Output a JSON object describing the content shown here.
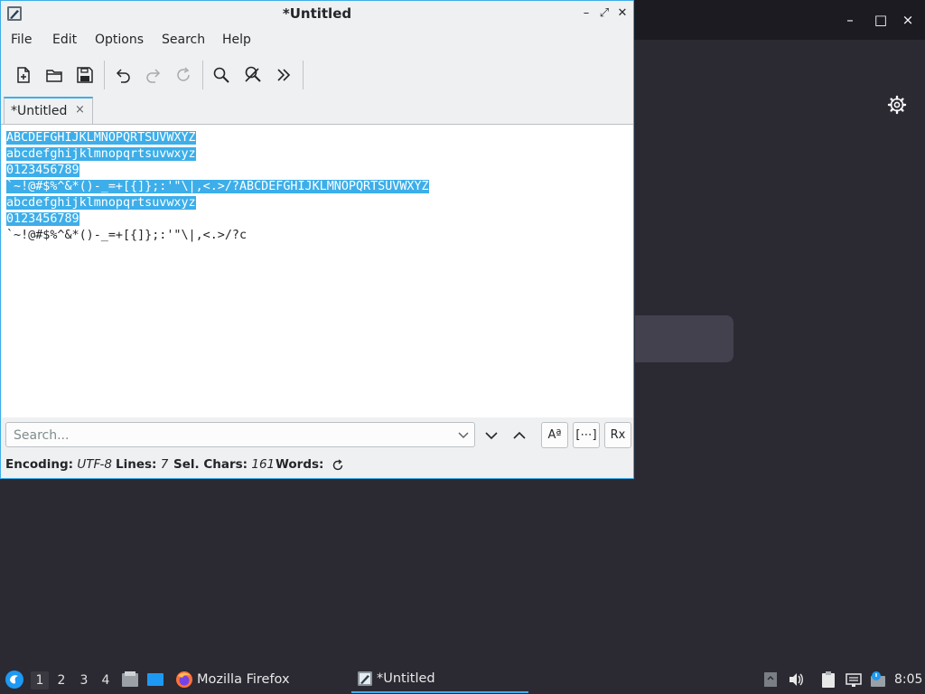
{
  "background_window": {
    "controls": {
      "minimize": "–",
      "maximize": "□",
      "close": "×"
    },
    "menu_icon": "hamburger-icon",
    "settings_icon": "gear-icon"
  },
  "editor_window": {
    "title": "*Untitled",
    "controls": {
      "minimize": "–",
      "maximize": "⤢",
      "close": "✕"
    },
    "menu": [
      "File",
      "Edit",
      "Options",
      "Search",
      "Help"
    ],
    "toolbar": [
      "new-file",
      "open-file",
      "save",
      "undo",
      "redo",
      "reload",
      "find",
      "find-replace",
      "more"
    ],
    "tab": {
      "label": "*Untitled",
      "close": "×"
    },
    "document": {
      "selected_lines": [
        "ABCDEFGHIJKLMNOPQRTSUVWXYZ",
        "abcdefghijklmnopqrtsuvwxyz",
        "0123456789",
        "`~!@#$%^&*()-_=+[{]};:'\"\\|,<.>/?ABCDEFGHIJKLMNOPQRTSUVWXYZ",
        "abcdefghijklmnopqrtsuvwxyz",
        "0123456789"
      ],
      "unselected_line": "`~!@#$%^&*()-_=+[{]};:'\"\\|,<.>/?c"
    },
    "search": {
      "placeholder": "Search...",
      "value": "",
      "options": {
        "match_case": "Aª",
        "whole_word": "[⋯]",
        "regex": "Rx"
      }
    },
    "status": {
      "encoding_label": "Encoding:",
      "encoding_value": "UTF-8",
      "lines_label": "Lines:",
      "lines_value": "7",
      "selchars_label": "Sel. Chars:",
      "selchars_value": "161",
      "words_label": "Words:"
    }
  },
  "taskbar": {
    "workspaces": [
      "1",
      "2",
      "3",
      "4"
    ],
    "active_workspace": "1",
    "tasks": [
      {
        "label": "Mozilla Firefox",
        "icon": "firefox-icon"
      },
      {
        "label": "*Untitled",
        "icon": "text-editor-icon"
      }
    ],
    "clock": "8:05"
  },
  "colors": {
    "accent": "#3daee9",
    "panel": "#2b2a33"
  }
}
